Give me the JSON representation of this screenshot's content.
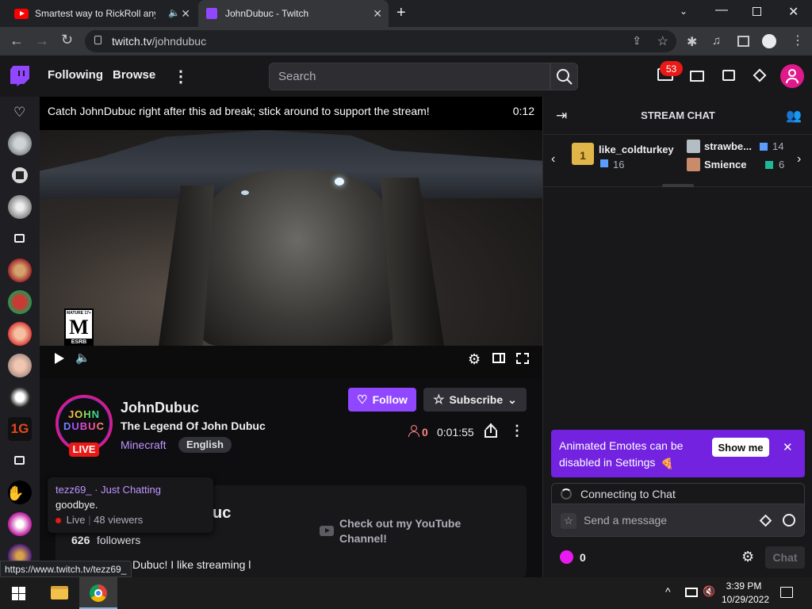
{
  "browser": {
    "tabs": [
      {
        "title": "Smartest way to RickRoll any",
        "active": false
      },
      {
        "title": "JohnDubuc - Twitch",
        "active": true
      }
    ],
    "url_domain": "twitch.tv",
    "url_path": "/johndubuc",
    "status_url": "https://www.twitch.tv/tezz69_"
  },
  "nav": {
    "following": "Following",
    "browse": "Browse",
    "search_placeholder": "Search",
    "notification_count": "53"
  },
  "video": {
    "ad_text": "Catch JohnDubuc right after this ad break; stick around to support the stream!",
    "ad_timer": "0:12",
    "rating_top": "MATURE 17+",
    "rating_letter": "M",
    "rating_bottom": "ESRB"
  },
  "channel": {
    "name": "JohnDubuc",
    "stream_title": "The Legend Of John Dubuc",
    "game": "Minecraft",
    "tag": "English",
    "live_label": "LIVE",
    "logo_line1": "JOHN",
    "logo_line2": "DUBUC",
    "viewers": "0",
    "uptime": "0:01:55",
    "follow_label": "Follow",
    "subscribe_label": "Subscribe",
    "about_title_partial": "uc",
    "followers_count": "626",
    "followers_label": "followers",
    "bio_partial": "Dubuc! I like streaming l",
    "youtube_text": "Check out my YouTube Channel!"
  },
  "tooltip": {
    "user": "tezz69_",
    "category": " · Just Chatting",
    "message": "goodbye.",
    "live": "Live",
    "viewers": "48 viewers"
  },
  "chat": {
    "header": "STREAM CHAT",
    "gifters": [
      {
        "name": "like_coldturkey",
        "count": "16",
        "rank": "1"
      },
      {
        "name": "strawbe...",
        "count": "14"
      },
      {
        "name": "Smience",
        "count": "6"
      }
    ],
    "notice_text": "Animated Emotes can be disabled in Settings",
    "show_me": "Show me",
    "connecting": "Connecting to Chat",
    "input_placeholder": "Send a message",
    "points": "0",
    "chat_button": "Chat"
  },
  "taskbar": {
    "time": "3:39 PM",
    "date": "10/29/2022"
  },
  "colors": {
    "twitch_purple": "#9147ff",
    "notice_purple": "#7323e0",
    "live_red": "#e91916",
    "badge_red": "#e91916"
  }
}
